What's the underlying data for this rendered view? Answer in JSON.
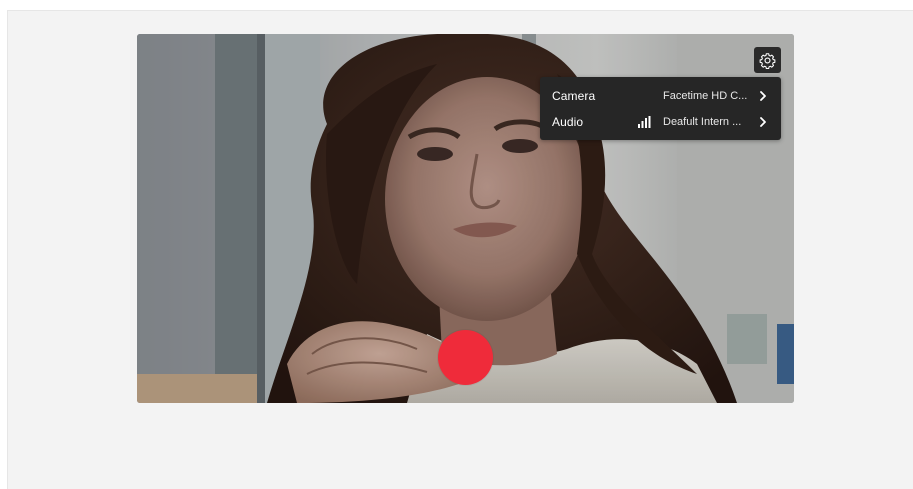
{
  "settings": {
    "icon": "gear-icon"
  },
  "menu": {
    "rows": [
      {
        "label": "Camera",
        "value": "Facetime HD C...",
        "icon": "chevron-right-icon"
      },
      {
        "label": "Audio",
        "value": "Deafult Intern ...",
        "level_icon": "audio-level-icon",
        "icon": "chevron-right-icon"
      }
    ]
  },
  "record": {
    "color": "#ef2b3a"
  },
  "colors": {
    "menu_bg": "#262626",
    "page_bg": "#f3f3f3"
  }
}
